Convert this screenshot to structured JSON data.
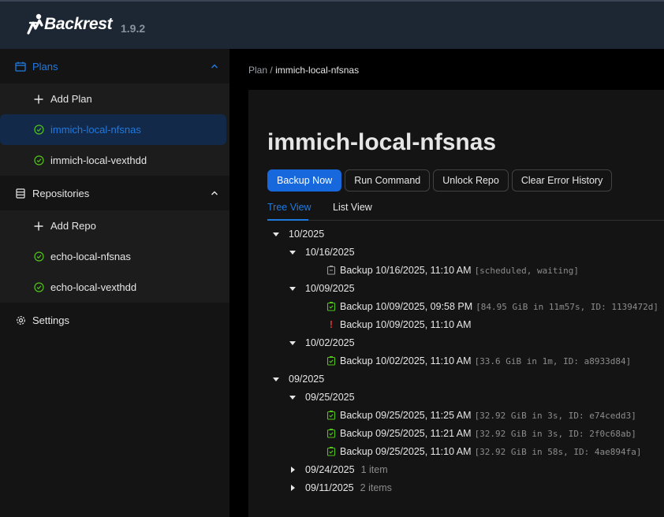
{
  "app": {
    "name": "Backrest",
    "version": "1.9.2"
  },
  "sidebar": {
    "plans": {
      "label": "Plans",
      "items": [
        {
          "label": "Add Plan"
        },
        {
          "label": "immich-local-nfsnas"
        },
        {
          "label": "immich-local-vexthdd"
        }
      ]
    },
    "repositories": {
      "label": "Repositories",
      "items": [
        {
          "label": "Add Repo"
        },
        {
          "label": "echo-local-nfsnas"
        },
        {
          "label": "echo-local-vexthdd"
        }
      ]
    },
    "settings": {
      "label": "Settings"
    }
  },
  "breadcrumb": {
    "parent": "Plan",
    "separator": "/",
    "current": "immich-local-nfsnas"
  },
  "plan": {
    "title": "immich-local-nfsnas",
    "buttons": {
      "backup_now": "Backup Now",
      "run_command": "Run Command",
      "unlock_repo": "Unlock Repo",
      "clear_error_history": "Clear Error History"
    },
    "tabs": {
      "tree_view": "Tree View",
      "list_view": "List View"
    }
  },
  "tree": {
    "m1": "10/2025",
    "d1": "10/16/2025",
    "b1": {
      "label": "Backup 10/16/2025, 11:10 AM",
      "meta": "[scheduled, waiting]"
    },
    "d2": "10/09/2025",
    "b2": {
      "label": "Backup 10/09/2025, 09:58 PM",
      "meta": "[84.95 GiB in 11m57s, ID: 1139472d]"
    },
    "b3": {
      "label": "Backup 10/09/2025, 11:10 AM",
      "mark": "!"
    },
    "d3": "10/02/2025",
    "b4": {
      "label": "Backup 10/02/2025, 11:10 AM",
      "meta": "[33.6 GiB in 1m, ID: a8933d84]"
    },
    "m2": "09/2025",
    "d4": "09/25/2025",
    "b5": {
      "label": "Backup 09/25/2025, 11:25 AM",
      "meta": "[32.92 GiB in 3s, ID: e74cedd3]"
    },
    "b6": {
      "label": "Backup 09/25/2025, 11:21 AM",
      "meta": "[32.92 GiB in 3s, ID: 2f0c68ab]"
    },
    "b7": {
      "label": "Backup 09/25/2025, 11:10 AM",
      "meta": "[32.92 GiB in 58s, ID: 4ae894fa]"
    },
    "d5": {
      "label": "09/24/2025",
      "count": "1 item"
    },
    "d6": {
      "label": "09/11/2025",
      "count": "2 items"
    }
  },
  "colors": {
    "accent": "#1668dc",
    "success": "#52c41a",
    "error": "#e5322d",
    "pending": "#9a9a9a"
  }
}
